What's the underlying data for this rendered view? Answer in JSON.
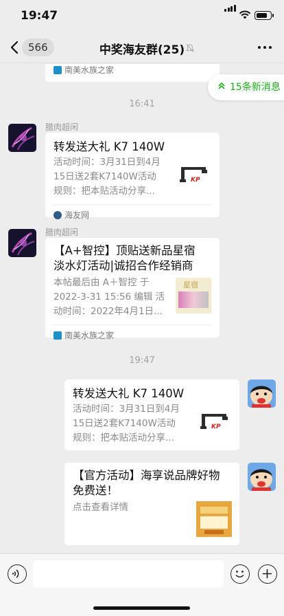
{
  "status": {
    "time": "19:47"
  },
  "nav": {
    "back_count": "566",
    "title": "中奖海友群(25)"
  },
  "new_messages": "15条新消息",
  "messages": [
    {
      "source": "南美水族之家"
    },
    {
      "time": "16:41"
    },
    {
      "sender": "腊肉超闲",
      "title": "转发送大礼 K7 140W",
      "desc": [
        "活动时间：3月31日到4月",
        "15日送2套K7140W活动",
        "规则：把本贴活动分享..."
      ],
      "thumb_label": "KP",
      "source": "海友网"
    },
    {
      "sender": "腊肉超闲",
      "title": [
        "【A+智控】顶贴送新品星宿",
        "淡水灯活动|诚招合作经销商"
      ],
      "desc": [
        "本帖最后由 A＋智控 于",
        "2022-3-31 15:56 编辑 活",
        "动时间：2022年4月1日..."
      ],
      "thumb_label": "星宿",
      "source": "南美水族之家"
    },
    {
      "time": "19:47"
    },
    {
      "title": "转发送大礼 K7 140W",
      "desc": [
        "活动时间：3月31日到4月",
        "15日送2套K7140W活动",
        "规则：把本贴活动分享..."
      ],
      "thumb_label": "KP"
    },
    {
      "title": [
        "【官方活动】海享说品牌好物",
        "免费送！"
      ],
      "desc": [
        "点击查看详情"
      ]
    }
  ],
  "colors": {
    "accent": "#1aad19",
    "background": "#ededed"
  },
  "icons": [
    "back-icon",
    "mute-icon",
    "more-icon",
    "voice-icon",
    "emoji-icon",
    "plus-icon"
  ]
}
